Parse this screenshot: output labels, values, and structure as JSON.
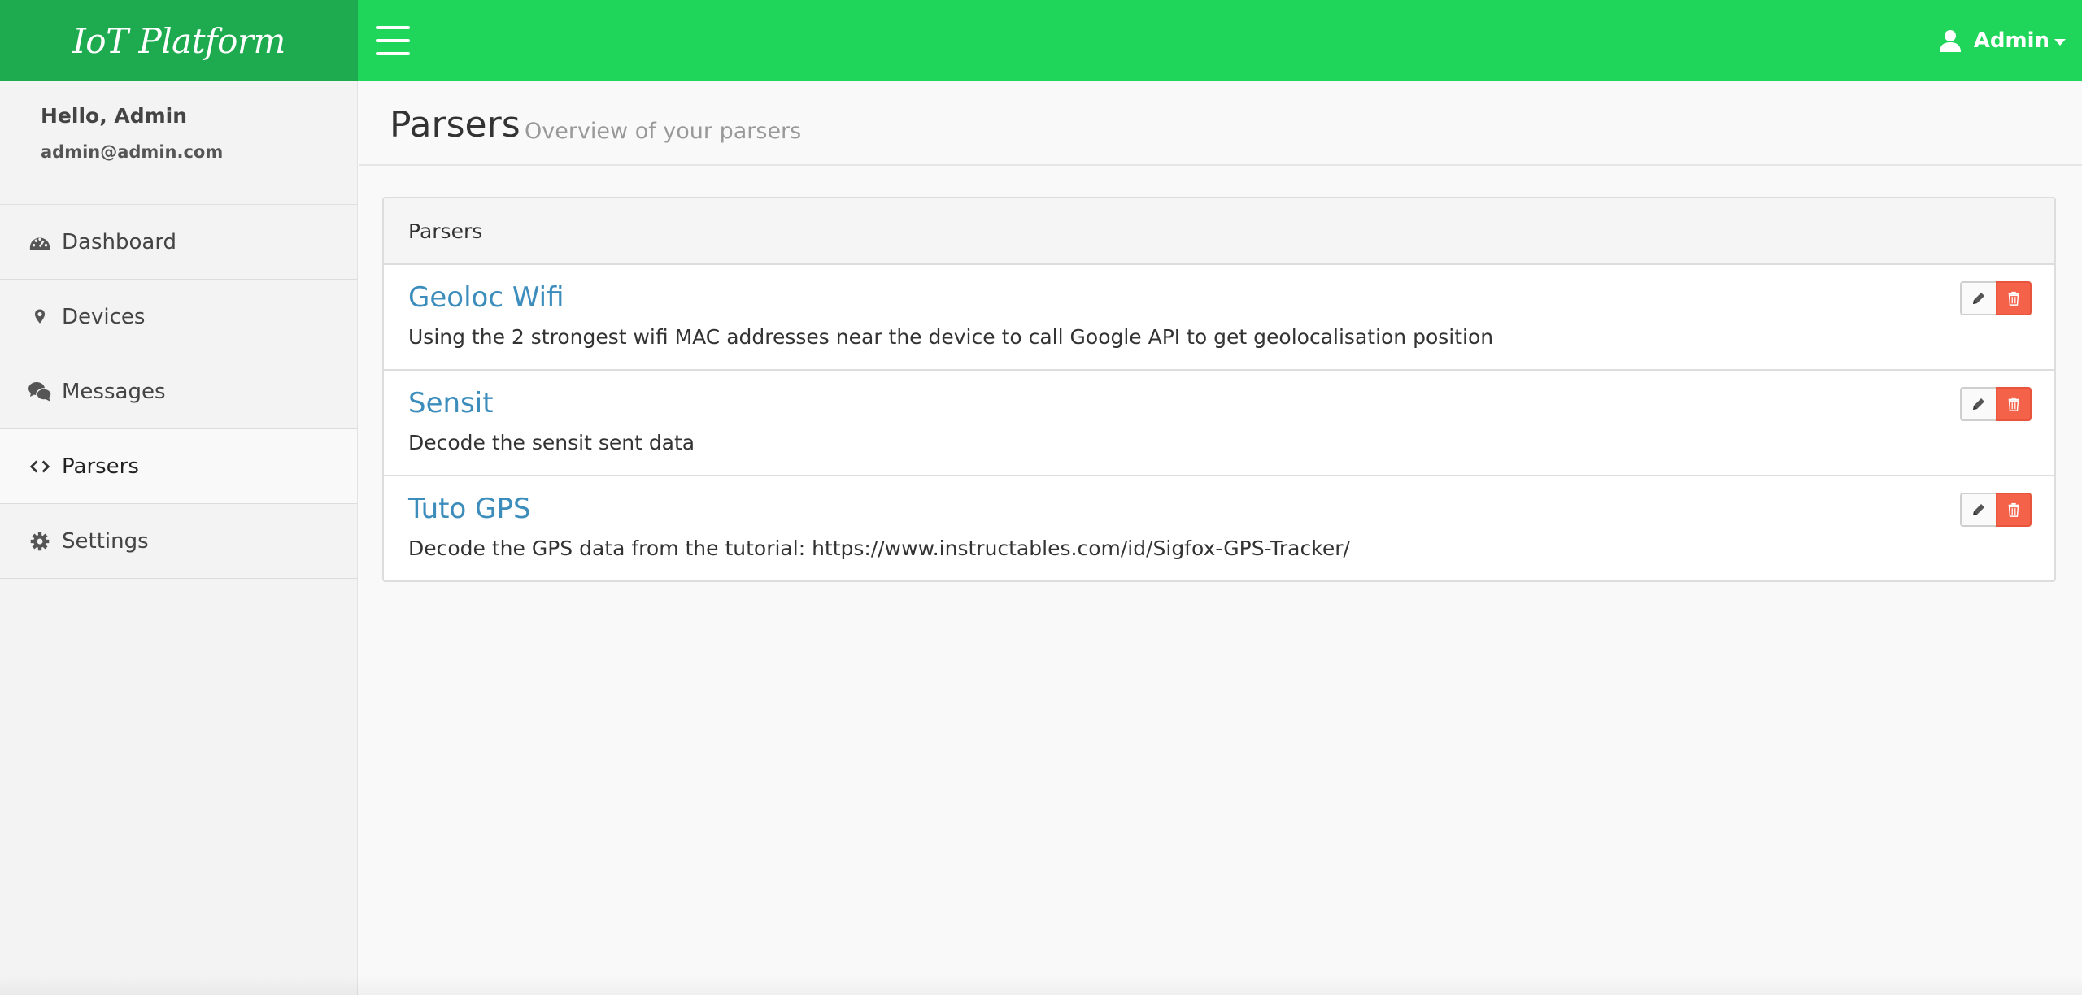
{
  "app": {
    "brand": "IoT Platform"
  },
  "header": {
    "user_name": "Admin"
  },
  "sidebar": {
    "hello": "Hello, Admin",
    "email": "admin@admin.com",
    "items": [
      {
        "label": "Dashboard",
        "icon": "dashboard-icon"
      },
      {
        "label": "Devices",
        "icon": "map-marker-icon"
      },
      {
        "label": "Messages",
        "icon": "chat-icon"
      },
      {
        "label": "Parsers",
        "icon": "code-icon",
        "active": true
      },
      {
        "label": "Settings",
        "icon": "gear-icon"
      }
    ]
  },
  "page": {
    "title": "Parsers",
    "subtitle": "Overview of your parsers"
  },
  "panel": {
    "heading": "Parsers",
    "rows": [
      {
        "title": "Geoloc Wifi",
        "description": "Using the 2 strongest wifi MAC addresses near the device to call Google API to get geolocalisation position"
      },
      {
        "title": "Sensit",
        "description": "Decode the sensit sent data"
      },
      {
        "title": "Tuto GPS",
        "description": "Decode the GPS data from the tutorial: https://www.instructables.com/id/Sigfox-GPS-Tracker/"
      }
    ]
  },
  "colors": {
    "topbar": "#1fd65a",
    "brand_bg": "#1eaa4e",
    "link": "#3c8dbc",
    "danger": "#f4624a"
  }
}
